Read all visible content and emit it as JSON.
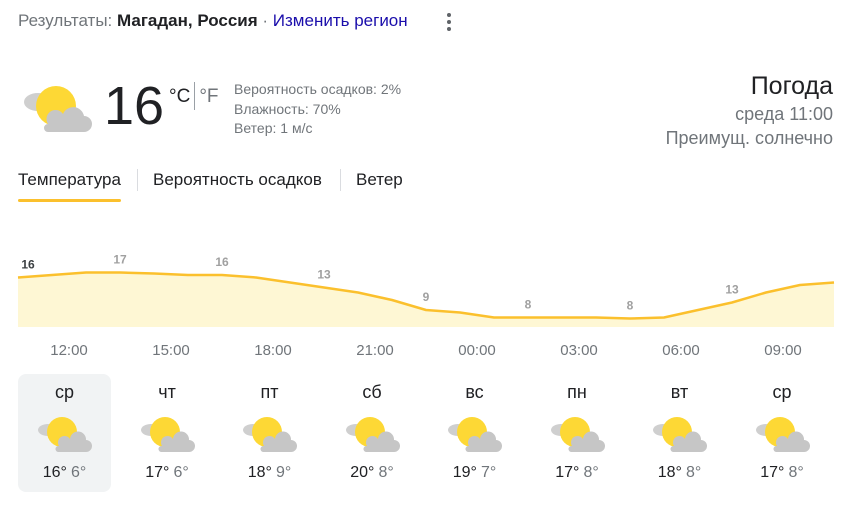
{
  "header": {
    "results_label": "Результаты:",
    "location": "Магадан, Россия",
    "separator": " · ",
    "change_region": "Изменить регион",
    "menu_icon": "more-vert-icon"
  },
  "current": {
    "icon": "partly-sunny-icon",
    "temperature": "16",
    "unit_c": "°C",
    "unit_f": "°F",
    "precip": "Вероятность осадков: 2%",
    "humidity": "Влажность: 70%",
    "wind": "Ветер: 1 м/с",
    "title": "Погода",
    "datetime": "среда 11:00",
    "condition": "Преимущ. солнечно"
  },
  "tabs": [
    {
      "label": "Температура",
      "active": true
    },
    {
      "label": "Вероятность осадков",
      "active": false
    },
    {
      "label": "Ветер",
      "active": false
    }
  ],
  "colors": {
    "accent": "#fbc02d",
    "fill": "#fef7d4",
    "sun": "#fdd835",
    "cloud": "#bdbdbd",
    "link": "#1a0dab"
  },
  "chart_data": {
    "type": "area",
    "x": [
      "11:00",
      "12:00",
      "13:00",
      "14:00",
      "15:00",
      "16:00",
      "17:00",
      "18:00",
      "19:00",
      "20:00",
      "21:00",
      "22:00",
      "23:00",
      "00:00",
      "01:00",
      "02:00",
      "03:00",
      "04:00",
      "05:00",
      "06:00",
      "07:00",
      "08:00",
      "09:00",
      "10:00"
    ],
    "values": [
      16,
      16.5,
      17,
      17,
      16.8,
      16.5,
      16.5,
      16,
      15,
      14,
      13,
      11.5,
      9.5,
      9,
      8,
      8,
      8,
      8,
      7.8,
      8,
      9.5,
      11,
      13,
      14.5,
      15
    ],
    "data_labels": [
      {
        "index": 0,
        "label": "16"
      },
      {
        "index": 3,
        "label": "17"
      },
      {
        "index": 6,
        "label": "16"
      },
      {
        "index": 9,
        "label": "13"
      },
      {
        "index": 12,
        "label": "9"
      },
      {
        "index": 15,
        "label": "8"
      },
      {
        "index": 18,
        "label": "8"
      },
      {
        "index": 21,
        "label": "13"
      }
    ],
    "hour_labels": [
      "12:00",
      "15:00",
      "18:00",
      "21:00",
      "00:00",
      "03:00",
      "06:00",
      "09:00"
    ],
    "ylim": [
      7.5,
      17.5
    ],
    "grid": false
  },
  "forecast": [
    {
      "day": "ср",
      "hi": "16°",
      "lo": "6°",
      "icon": "partly-sunny-icon",
      "selected": true
    },
    {
      "day": "чт",
      "hi": "17°",
      "lo": "6°",
      "icon": "partly-sunny-icon",
      "selected": false
    },
    {
      "day": "пт",
      "hi": "18°",
      "lo": "9°",
      "icon": "partly-sunny-icon",
      "selected": false
    },
    {
      "day": "сб",
      "hi": "20°",
      "lo": "8°",
      "icon": "partly-sunny-icon",
      "selected": false
    },
    {
      "day": "вс",
      "hi": "19°",
      "lo": "7°",
      "icon": "partly-sunny-icon",
      "selected": false
    },
    {
      "day": "пн",
      "hi": "17°",
      "lo": "8°",
      "icon": "partly-sunny-icon",
      "selected": false
    },
    {
      "day": "вт",
      "hi": "18°",
      "lo": "8°",
      "icon": "partly-sunny-icon",
      "selected": false
    },
    {
      "day": "ср",
      "hi": "17°",
      "lo": "8°",
      "icon": "partly-sunny-icon",
      "selected": false
    }
  ]
}
